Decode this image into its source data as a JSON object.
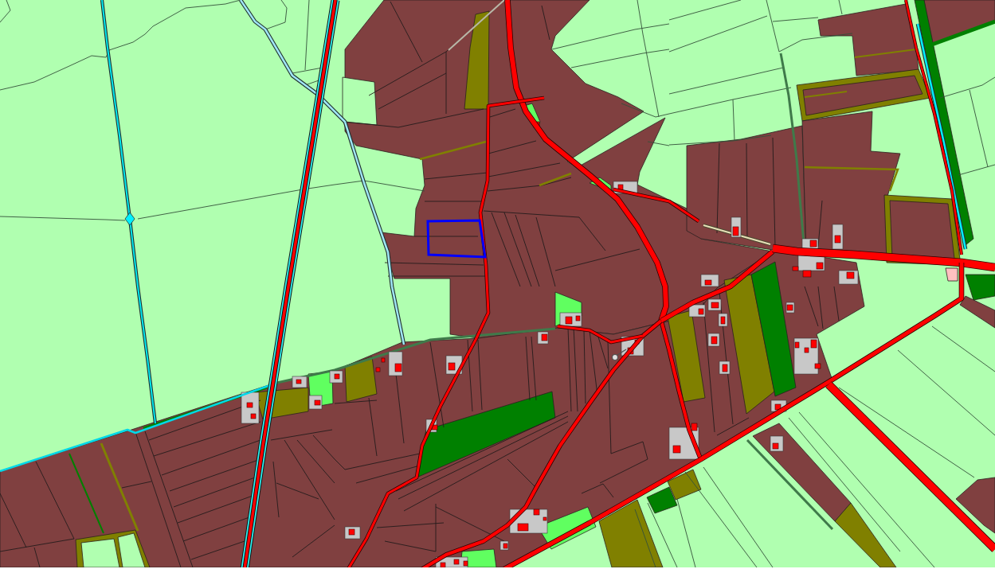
{
  "map": {
    "land_cover": [
      {
        "color": "#b0ffb0"
      },
      {
        "color": "#804040"
      },
      {
        "color": "#808000"
      },
      {
        "color": "#008000"
      },
      {
        "color": "#60ff60"
      },
      {
        "color": "#c8c8c8"
      },
      {
        "color": "#ffc0c0"
      }
    ],
    "parcel_highlighted": true
  }
}
